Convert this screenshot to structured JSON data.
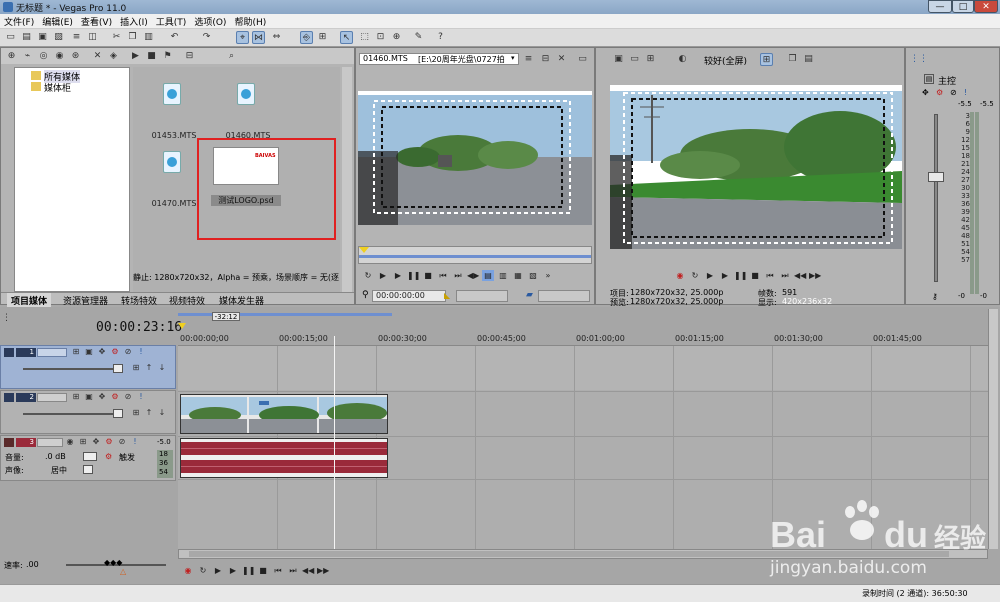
{
  "window": {
    "title": "无标题 * - Vegas Pro 11.0",
    "min": "—",
    "max": "□",
    "close": "✕"
  },
  "menu": [
    "文件(F)",
    "编辑(E)",
    "查看(V)",
    "插入(I)",
    "工具(T)",
    "选项(O)",
    "帮助(H)"
  ],
  "explorer": {
    "tree": [
      "所有媒体",
      "媒体柜"
    ],
    "items": [
      {
        "name": "01453.MTS"
      },
      {
        "name": "01460.MTS"
      },
      {
        "name": "01470.MTS"
      },
      {
        "name": "测试LOGO.psd",
        "thumb_text": "BAIVAS"
      }
    ],
    "status": "静止: 1280x720x32，Alpha = 预乘，场景顺序 = 无(逐",
    "highlight_color": "#e02020"
  },
  "tabs": [
    "项目媒体",
    "资源管理器",
    "转场特效",
    "视频特效",
    "媒体发生器"
  ],
  "trimmer": {
    "file_label": "01460.MTS",
    "path": "[E:\\20周年光盘\\0727拍",
    "timecode": "00:00:00:00"
  },
  "preview": {
    "quality": "较好(全屏)",
    "project_label": "项目:",
    "project_value": "1280x720x32, 25.000p",
    "preview_label": "预览:",
    "preview_value": "1280x720x32, 25.000p",
    "frame_label": "帧数:",
    "frame_value": "591",
    "display_label": "显示:",
    "display_value": "420x236x32"
  },
  "master": {
    "title": "主控",
    "scale": [
      "-5.5",
      "-5.5",
      "3",
      "6",
      "9",
      "12",
      "15",
      "18",
      "21",
      "24",
      "27",
      "30",
      "33",
      "36",
      "39",
      "42",
      "45",
      "48",
      "51",
      "54",
      "57",
      "-0",
      "-0"
    ],
    "top_left": "-5.5",
    "top_right": "-5.5",
    "bottom_left": "-0",
    "bottom_right": "-0"
  },
  "timeline": {
    "timecode": "00:00:23:16",
    "marker": "-32:12",
    "ruler": [
      "00:00:00;00",
      "00:00:15;00",
      "00:00:30;00",
      "00:00:45;00",
      "00:01:00;00",
      "00:01:15;00",
      "00:01:30;00",
      "00:01:45;00"
    ],
    "tracks": [
      {
        "num": "1",
        "type": "video"
      },
      {
        "num": "2",
        "type": "video"
      },
      {
        "num": "3",
        "type": "audio",
        "volume_label": "音量:",
        "volume": ".0 dB",
        "pan_label": "声像:",
        "pan": "居中",
        "mode": "触发",
        "meter": [
          "-5.0",
          "18",
          "36",
          "54"
        ]
      }
    ],
    "rate_label": "速率:",
    "rate": ".00"
  },
  "statusbar": {
    "record_time": "录制时间 (2 通道): 36:50:30"
  },
  "watermark": {
    "brand": "Bai",
    "brand2": "du",
    "brand3": "经验",
    "url": "jingyan.baidu.com"
  }
}
